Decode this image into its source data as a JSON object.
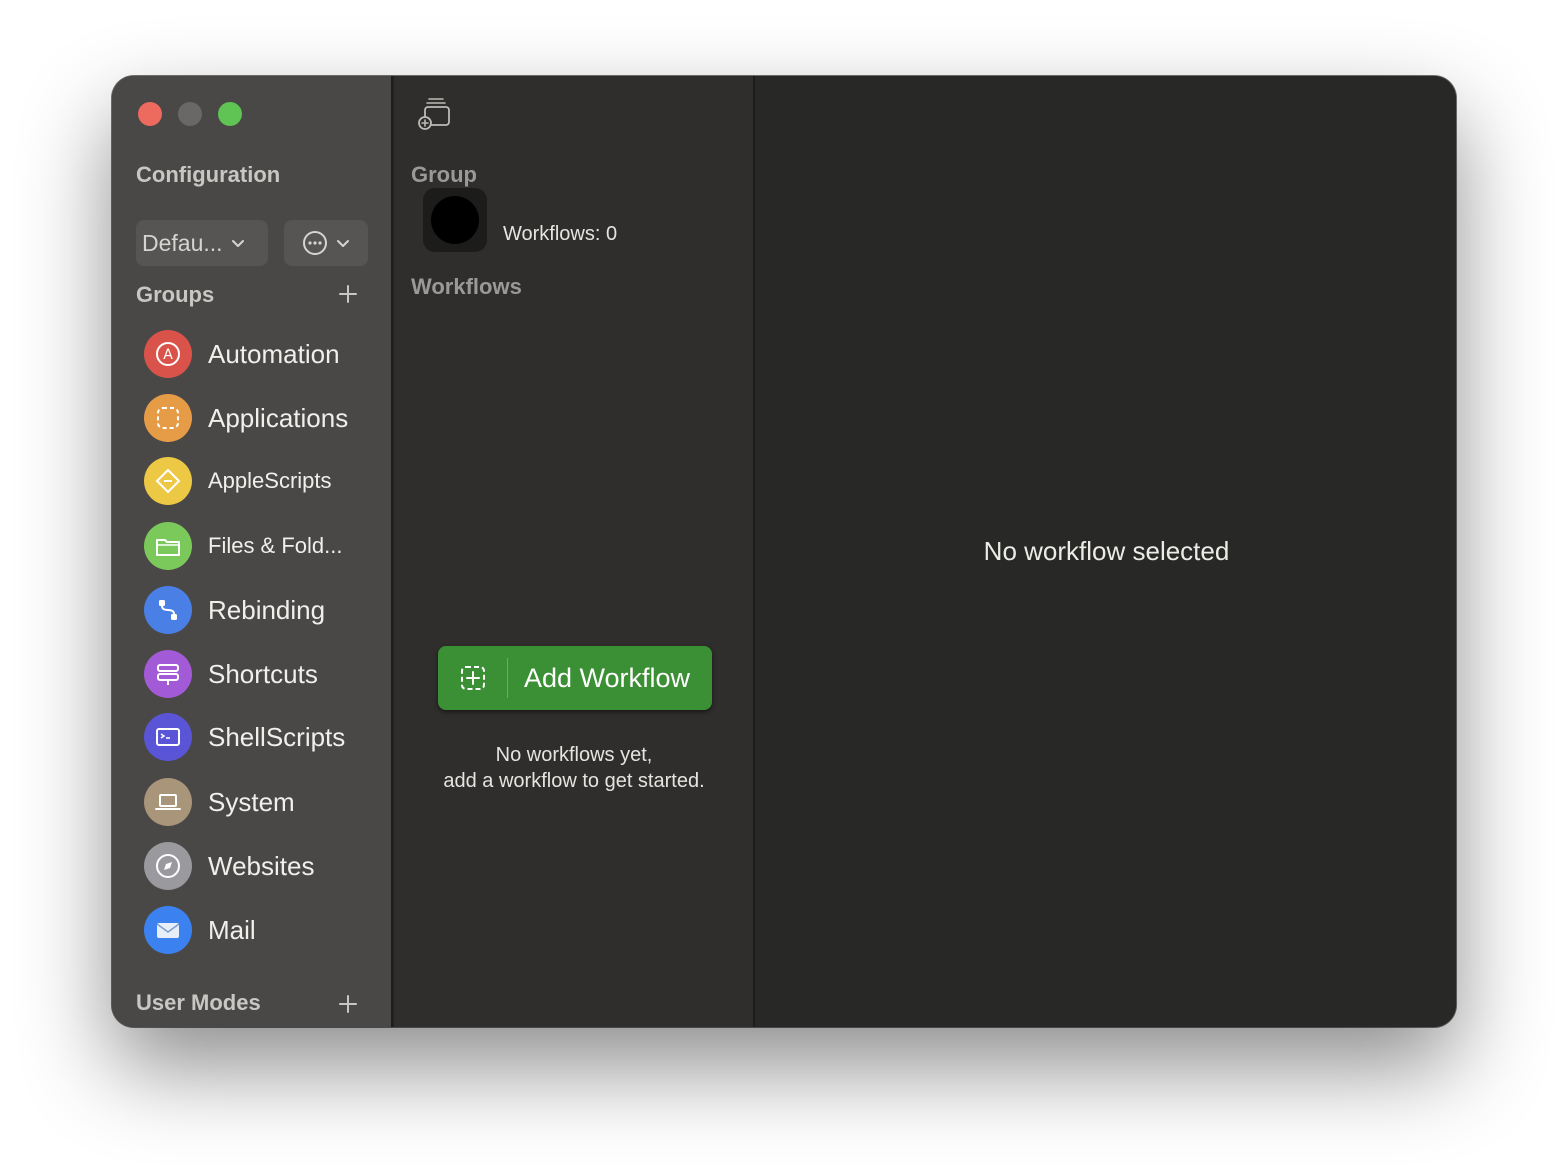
{
  "sidebar": {
    "configuration_title": "Configuration",
    "config_popup_label": "Defau...",
    "more_icon": "ellipsis-circle-icon",
    "groups_title": "Groups",
    "groups": [
      {
        "label": "Automation",
        "icon": "automation-icon",
        "color": "#d9534a"
      },
      {
        "label": "Applications",
        "icon": "applications-icon",
        "color": "#e69b46"
      },
      {
        "label": "AppleScripts",
        "icon": "applescript-icon",
        "color": "#edc844"
      },
      {
        "label": "Files & Fold...",
        "icon": "folder-icon",
        "color": "#7bc95b"
      },
      {
        "label": "Rebinding",
        "icon": "rebinding-icon",
        "color": "#4a7fe6"
      },
      {
        "label": "Shortcuts",
        "icon": "shortcuts-icon",
        "color": "#a35ad6"
      },
      {
        "label": "ShellScripts",
        "icon": "terminal-icon",
        "color": "#5a55d6"
      },
      {
        "label": "System",
        "icon": "laptop-icon",
        "color": "#a8957a"
      },
      {
        "label": "Websites",
        "icon": "compass-icon",
        "color": "#9a9a9e"
      },
      {
        "label": "Mail",
        "icon": "mail-icon",
        "color": "#3b82f0"
      }
    ],
    "user_modes_title": "User Modes"
  },
  "middle": {
    "group_title": "Group",
    "workflow_count": "Workflows: 0",
    "workflows_title": "Workflows",
    "add_workflow_label": "Add Workflow",
    "empty_line1": "No workflows yet,",
    "empty_line2": "add a workflow to get started."
  },
  "detail": {
    "empty_message": "No workflow selected"
  },
  "colors": {
    "accent_green": "#3b8f34",
    "close": "#ed6a5e",
    "zoom": "#5fc454"
  }
}
